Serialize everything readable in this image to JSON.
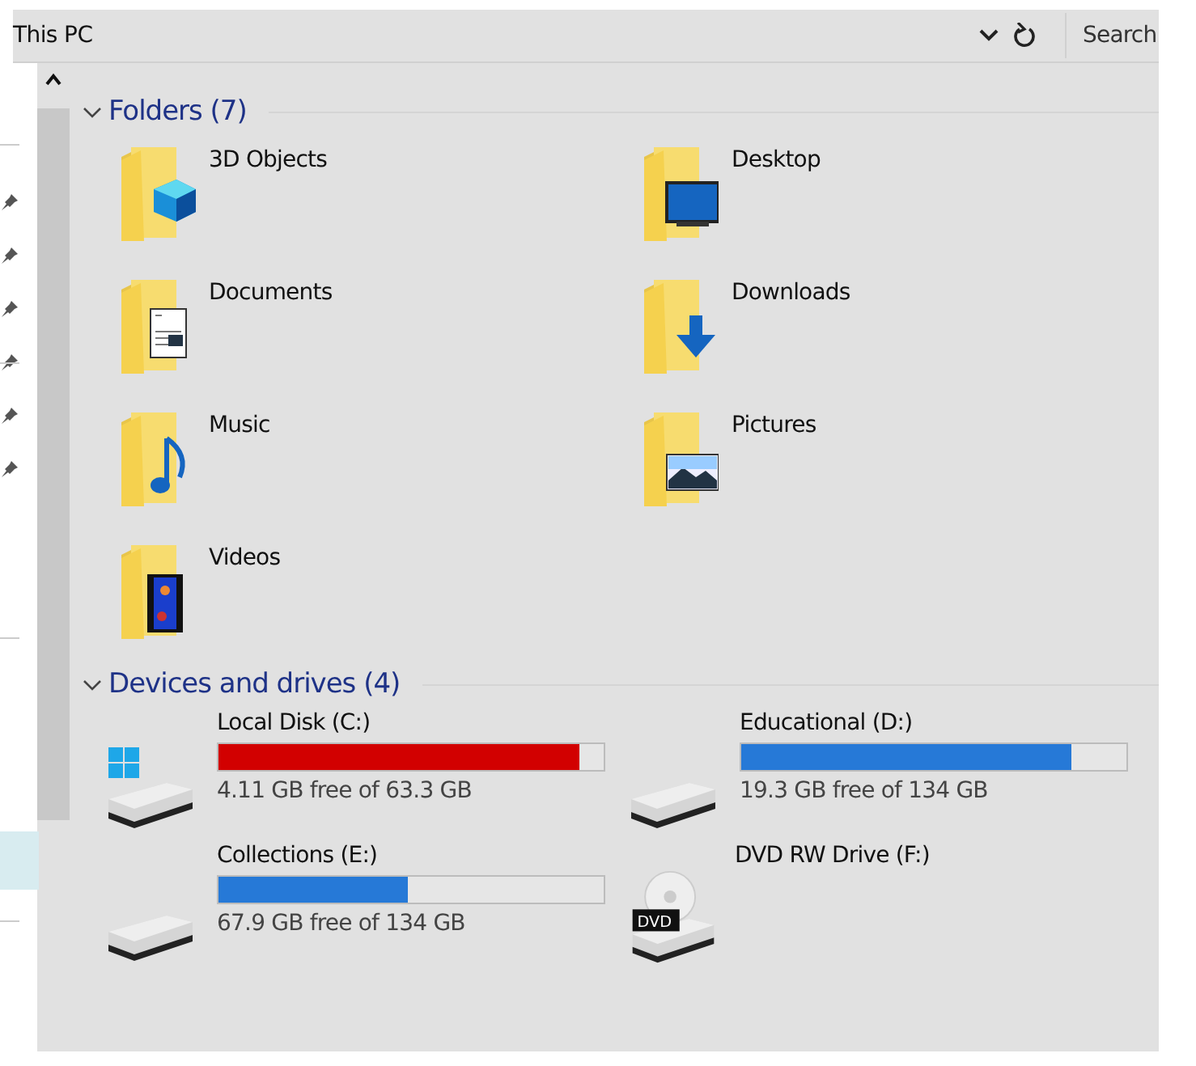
{
  "address_bar": {
    "path": "This PC",
    "search": {
      "placeholder": "Search"
    }
  },
  "sections": [
    {
      "title": "Folders (7)",
      "expanded": true,
      "kind": "folders",
      "items": [
        {
          "name": "3D Objects",
          "kind": "objects3d"
        },
        {
          "name": "Desktop",
          "kind": "desktop"
        },
        {
          "name": "Documents",
          "kind": "documents"
        },
        {
          "name": "Downloads",
          "kind": "downloads"
        },
        {
          "name": "Music",
          "kind": "music"
        },
        {
          "name": "Pictures",
          "kind": "pictures"
        },
        {
          "name": "Videos",
          "kind": "videos"
        }
      ]
    },
    {
      "title": "Devices and drives (4)",
      "expanded": true,
      "kind": "drives",
      "items": [
        {
          "name": "Local Disk (C:)",
          "kind": "system",
          "level": 0.935,
          "low_space": true,
          "free": "4.11 GB free of 63.3 GB"
        },
        {
          "name": "Educational (D:)",
          "kind": "disk",
          "level": 0.856,
          "low_space": false,
          "free": "19.3 GB free of 134 GB"
        },
        {
          "name": "Collections (E:)",
          "kind": "disk",
          "level": 0.493,
          "low_space": false,
          "free": "67.9 GB free of 134 GB"
        },
        {
          "name": "DVD RW Drive (F:)",
          "kind": "dvd",
          "label": "DVD"
        }
      ]
    }
  ]
}
